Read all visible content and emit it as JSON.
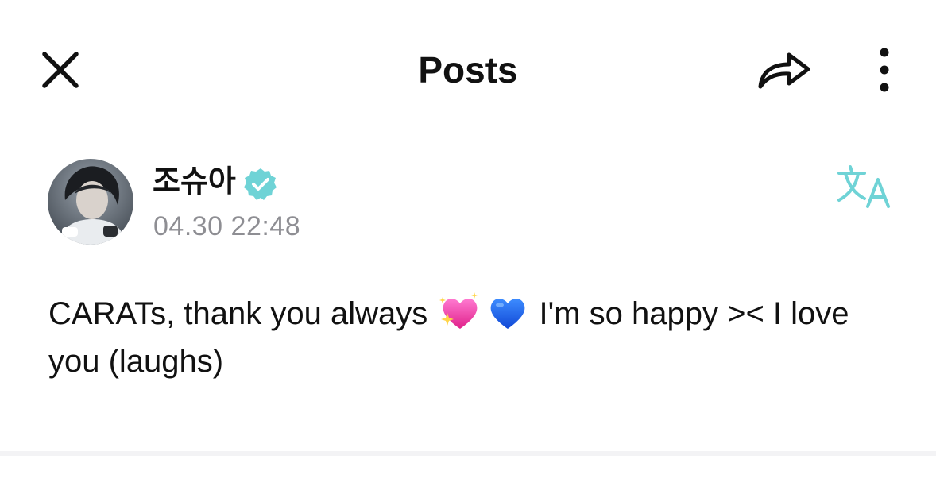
{
  "header": {
    "title": "Posts",
    "close_icon": "close-icon",
    "share_icon": "share-icon",
    "more_icon": "more-vertical-icon"
  },
  "post": {
    "author": "조슈아",
    "verified_icon": "verified-badge-icon",
    "timestamp": "04.30 22:48",
    "translate_icon": "translate-icon",
    "body_part1": "CARATs, thank you always ",
    "emoji1": "sparkling-heart-emoji",
    "emoji2": "blue-heart-emoji",
    "body_part2": " I'm so happy >< I love you (laughs)"
  },
  "colors": {
    "accent_teal": "#6fd3d6",
    "timestamp_gray": "#8e8e93",
    "text": "#111111",
    "divider": "#f3f3f5"
  }
}
